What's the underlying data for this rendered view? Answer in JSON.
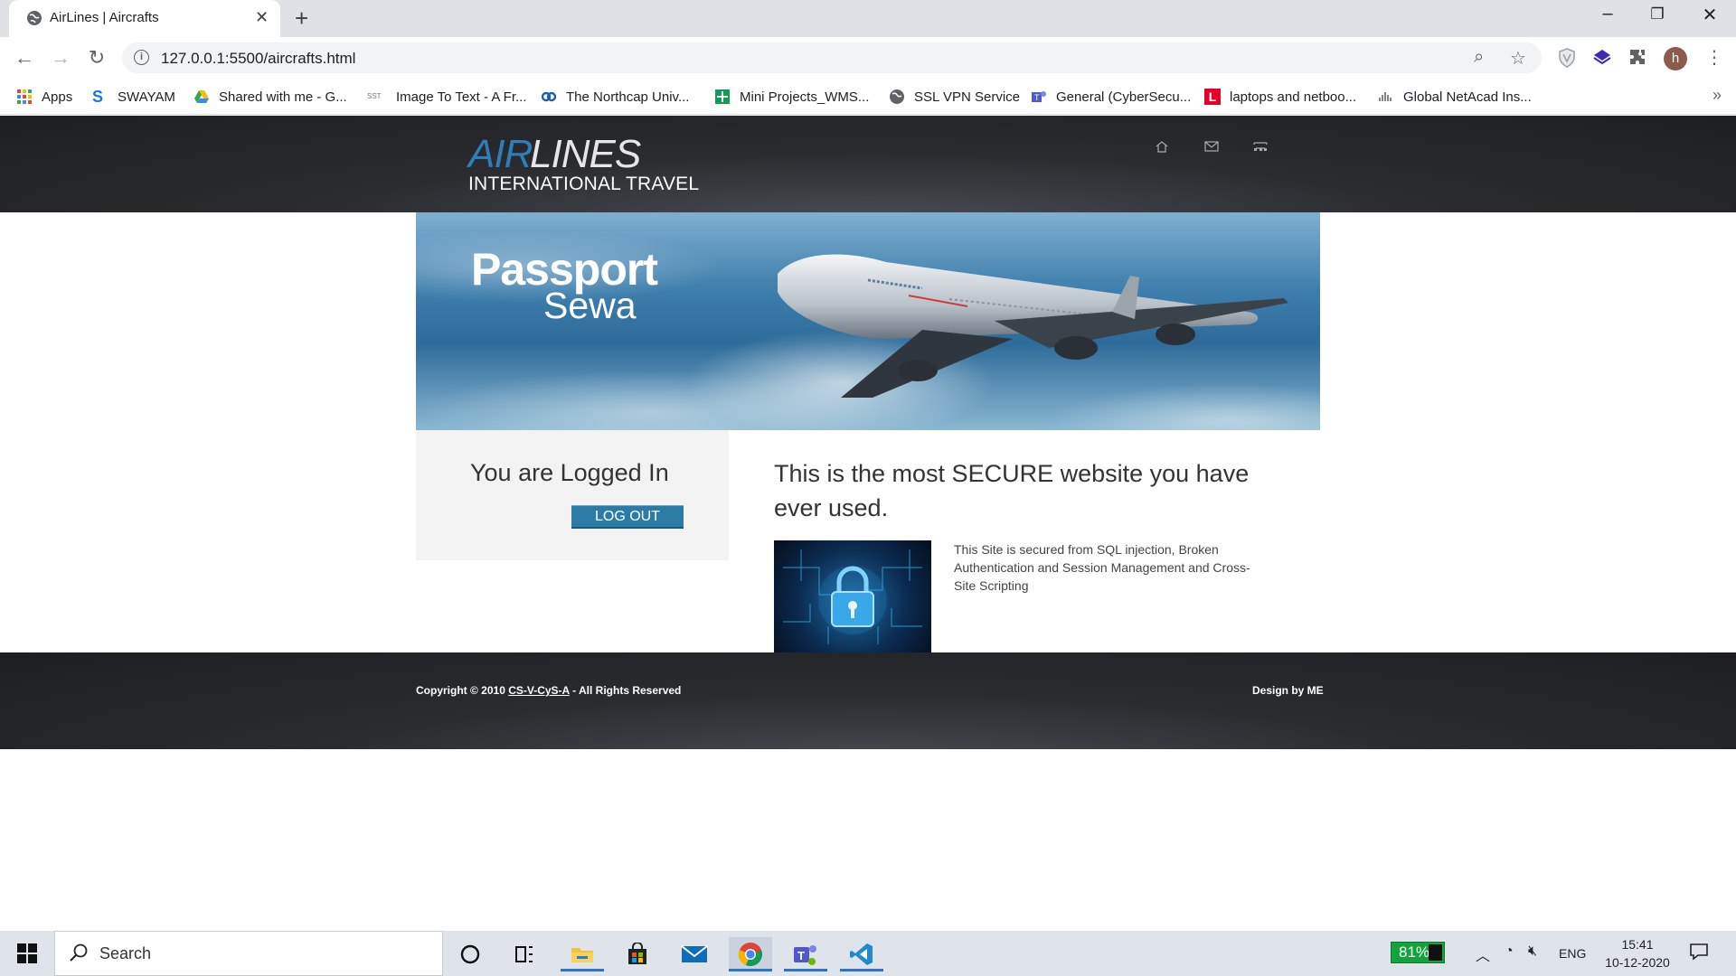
{
  "browser": {
    "tab_title": "AirLines | Aircrafts",
    "url": "127.0.0.1:5500/aircrafts.html",
    "avatar_letter": "h"
  },
  "bookmarks": [
    {
      "label": "Apps",
      "icon": "apps-grid-icon"
    },
    {
      "label": "SWAYAM",
      "icon": "swayam-icon"
    },
    {
      "label": "Shared with me - G...",
      "icon": "google-drive-icon"
    },
    {
      "label": "Image To Text - A Fr...",
      "icon": "sst-icon"
    },
    {
      "label": "The Northcap Univ...",
      "icon": "link-icon"
    },
    {
      "label": "Mini Projects_WMS...",
      "icon": "sheets-icon"
    },
    {
      "label": "SSL VPN Service",
      "icon": "globe-icon"
    },
    {
      "label": "General (CyberSecu...",
      "icon": "teams-icon"
    },
    {
      "label": "laptops and netboo...",
      "icon": "l-red-icon"
    },
    {
      "label": "Global NetAcad Ins...",
      "icon": "cisco-icon"
    }
  ],
  "site": {
    "logo_air": "AIR",
    "logo_lines": "LINES",
    "logo_sub": "INTERNATIONAL TRAVEL",
    "banner_title": "Passport",
    "banner_sub": "Sewa",
    "login_title": "You are Logged In",
    "logout_label": "LOG OUT",
    "secure_title": "This is the most SECURE website you have ever used.",
    "secure_text": "This Site is secured from SQL injection, Broken Authentication and Session Management and Cross-Site Scripting",
    "footer_prefix": "Copyright © 2010 ",
    "footer_link": "CS-V-CyS-A",
    "footer_suffix": " - All Rights Reserved",
    "footer_right": "Design by ME"
  },
  "taskbar": {
    "search_label": "Search",
    "battery": "81%",
    "language": "ENG",
    "time": "15:41",
    "date": "10-12-2020"
  },
  "colors": {
    "brand_blue": "#2f7eb5",
    "button_blue": "#2a7ca7",
    "header_dark": "#1d1e21"
  }
}
